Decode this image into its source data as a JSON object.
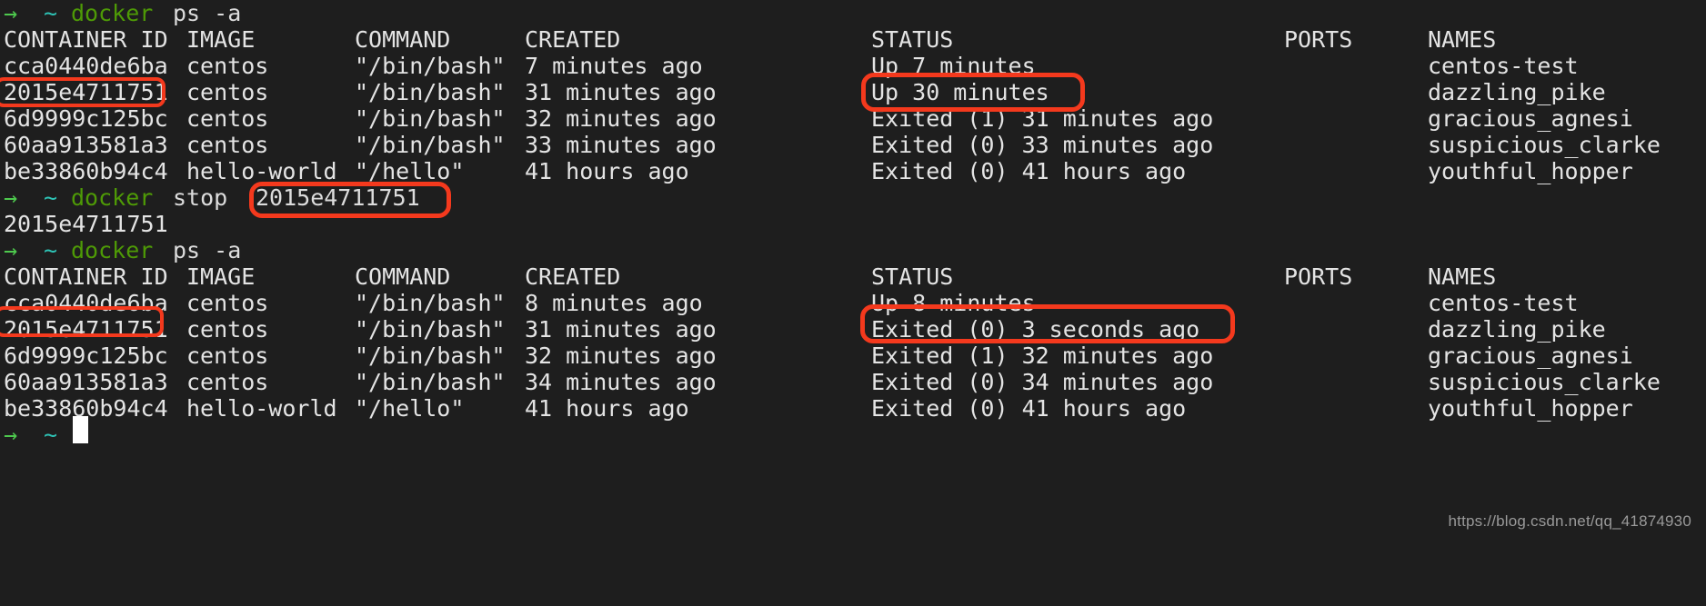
{
  "terminal": {
    "background_color": "#1e1e1e",
    "foreground_color": "#e4e4e4",
    "highlight_color": "#f4391d",
    "prompt": {
      "arrow": "→",
      "tilde": "~"
    },
    "columns": {
      "container_id": "CONTAINER ID",
      "image": "IMAGE",
      "command": "COMMAND",
      "created": "CREATED",
      "status": "STATUS",
      "ports": "PORTS",
      "names": "NAMES"
    },
    "commands": {
      "ps_first": {
        "program": "docker",
        "args": "ps -a"
      },
      "stop": {
        "program": "docker",
        "args": "stop",
        "target": "2015e4711751"
      },
      "ps_second": {
        "program": "docker",
        "args": "ps -a"
      }
    },
    "stop_output": "2015e4711751",
    "table_first": [
      {
        "id": "cca0440de6ba",
        "image": "centos",
        "command": "\"/bin/bash\"",
        "created": "7 minutes ago",
        "status": "Up 7 minutes",
        "ports": "",
        "names": "centos-test"
      },
      {
        "id": "2015e4711751",
        "image": "centos",
        "command": "\"/bin/bash\"",
        "created": "31 minutes ago",
        "status": "Up 30 minutes",
        "ports": "",
        "names": "dazzling_pike"
      },
      {
        "id": "6d9999c125bc",
        "image": "centos",
        "command": "\"/bin/bash\"",
        "created": "32 minutes ago",
        "status": "Exited (1) 31 minutes ago",
        "ports": "",
        "names": "gracious_agnesi"
      },
      {
        "id": "60aa913581a3",
        "image": "centos",
        "command": "\"/bin/bash\"",
        "created": "33 minutes ago",
        "status": "Exited (0) 33 minutes ago",
        "ports": "",
        "names": "suspicious_clarke"
      },
      {
        "id": "be33860b94c4",
        "image": "hello-world",
        "command": "\"/hello\"",
        "created": "41 hours ago",
        "status": "Exited (0) 41 hours ago",
        "ports": "",
        "names": "youthful_hopper"
      }
    ],
    "table_second": [
      {
        "id": "cca0440de6ba",
        "image": "centos",
        "command": "\"/bin/bash\"",
        "created": "8 minutes ago",
        "status": "Up 8 minutes",
        "ports": "",
        "names": "centos-test"
      },
      {
        "id": "2015e4711751",
        "image": "centos",
        "command": "\"/bin/bash\"",
        "created": "31 minutes ago",
        "status": "Exited (0) 3 seconds ago",
        "ports": "",
        "names": "dazzling_pike"
      },
      {
        "id": "6d9999c125bc",
        "image": "centos",
        "command": "\"/bin/bash\"",
        "created": "32 minutes ago",
        "status": "Exited (1) 32 minutes ago",
        "ports": "",
        "names": "gracious_agnesi"
      },
      {
        "id": "60aa913581a3",
        "image": "centos",
        "command": "\"/bin/bash\"",
        "created": "34 minutes ago",
        "status": "Exited (0) 34 minutes ago",
        "ports": "",
        "names": "suspicious_clarke"
      },
      {
        "id": "be33860b94c4",
        "image": "hello-world",
        "command": "\"/hello\"",
        "created": "41 hours ago",
        "status": "Exited (0) 41 hours ago",
        "ports": "",
        "names": "youthful_hopper"
      }
    ],
    "watermark": "https://blog.csdn.net/qq_41874930"
  }
}
